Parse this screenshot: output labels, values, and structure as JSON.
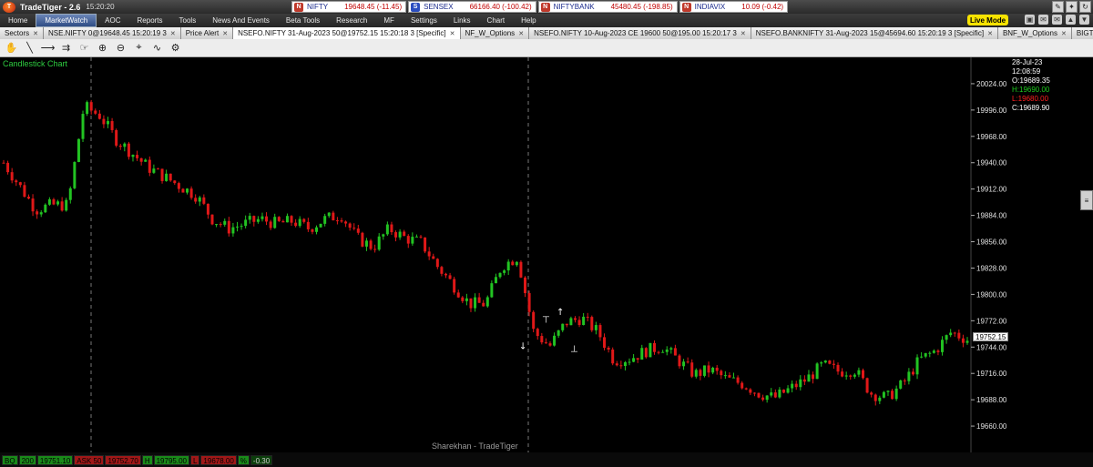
{
  "app": {
    "title": "TradeTiger - 2.6",
    "time": "15:20:20",
    "logo": "T"
  },
  "tickers": [
    {
      "icon_color": "#c0392b",
      "icon": "N",
      "name": "NIFTY",
      "value": "19648.45 (-11.45)"
    },
    {
      "icon_color": "#2b4ec0",
      "icon": "S",
      "name": "SENSEX",
      "value": "66166.40 (-100.42)"
    },
    {
      "icon_color": "#c0392b",
      "icon": "N",
      "name": "NIFTYBANK",
      "value": "45480.45 (-198.85)"
    },
    {
      "icon_color": "#c0392b",
      "icon": "N",
      "name": "INDIAVIX",
      "value": "10.09 (-0.42)"
    }
  ],
  "window_controls": [
    "✎",
    "✦",
    "↻"
  ],
  "menu": [
    "Home",
    "MarketWatch",
    "AOC",
    "Reports",
    "Tools",
    "News And Events",
    "Beta Tools",
    "Research",
    "MF",
    "Settings",
    "Links",
    "Chart",
    "Help"
  ],
  "menu_active_index": 1,
  "live_mode": "Live Mode",
  "menu_icons": [
    "▣",
    "✉",
    "✉",
    "▲",
    "▼"
  ],
  "tabs": [
    "Sectors",
    "NSE.NIFTY 0@19648.45 15:20:19 3",
    "Price Alert",
    "NSEFO.NIFTY 31-Aug-2023 50@19752.15 15:20:18 3 [Specific]",
    "NF_W_Options",
    "NSEFO.NIFTY 10-Aug-2023 CE 19600 50@195.00 15:20:17 3",
    "NSEFO.BANKNIFTY 31-Aug-2023 15@45694.60 15:20:19 3 [Specific]",
    "BNF_W_Options",
    "BIGTRADELIST"
  ],
  "active_tab_index": 3,
  "toolbar": [
    {
      "name": "pointer-icon",
      "glyph": "✋"
    },
    {
      "name": "line-tool-icon",
      "glyph": "╲"
    },
    {
      "name": "ray-tool-icon",
      "glyph": "⟶"
    },
    {
      "name": "channel-tool-icon",
      "glyph": "⇉"
    },
    {
      "name": "hand-tool-icon",
      "glyph": "☞"
    },
    {
      "name": "zoom-in-icon",
      "glyph": "⊕"
    },
    {
      "name": "zoom-out-icon",
      "glyph": "⊖"
    },
    {
      "name": "crosshair-icon",
      "glyph": "⌖"
    },
    {
      "name": "indicator-icon",
      "glyph": "∿"
    },
    {
      "name": "settings-icon",
      "glyph": "⚙"
    }
  ],
  "chart": {
    "title": "Candlestick Chart",
    "watermark": "Sharekhan - TradeTiger",
    "date": "28-Jul-23",
    "time": "12:08:59",
    "open": "O:19689.35",
    "high": "H:19690.00",
    "low": "L:19680.00",
    "close": "C:19689.90",
    "last_price": "19752.15",
    "side_handle": "≡",
    "up_color": "#22c322",
    "down_color": "#e01818"
  },
  "chart_data": {
    "type": "candlestick",
    "y_ticks": [
      "20024.00",
      "19996.00",
      "19968.00",
      "19940.00",
      "19912.00",
      "19884.00",
      "19856.00",
      "19828.00",
      "19800.00",
      "19772.00",
      "19744.00",
      "19716.00",
      "19688.00",
      "19660.00"
    ],
    "ylim": [
      19632,
      20052
    ],
    "close_path": [
      19940,
      19915,
      19890,
      19895,
      19895,
      20000,
      19990,
      19965,
      19950,
      19935,
      19925,
      19915,
      19905,
      19880,
      19870,
      19875,
      19880,
      19875,
      19878,
      19870,
      19880,
      19885,
      19860,
      19850,
      19870,
      19860,
      19855,
      19830,
      19810,
      19790,
      19790,
      19830,
      19840,
      19760,
      19745,
      19770,
      19775,
      19760,
      19730,
      19732,
      19740,
      19745,
      19730,
      19715,
      19720,
      19710,
      19705,
      19695,
      19690,
      19700,
      19710,
      19725,
      19718,
      19720,
      19695,
      19690,
      19705,
      19730,
      19740,
      19760,
      19752
    ]
  },
  "status_bar": [
    {
      "text": "BQ",
      "style": "g"
    },
    {
      "text": "200",
      "style": "g"
    },
    {
      "text": "19751.10",
      "style": "g"
    },
    {
      "text": "ASK 50",
      "style": "r"
    },
    {
      "text": "19752.70",
      "style": "r"
    },
    {
      "text": "H",
      "style": "g"
    },
    {
      "text": "19795.00",
      "style": "g"
    },
    {
      "text": "L",
      "style": "r"
    },
    {
      "text": "19678.00",
      "style": "r"
    },
    {
      "text": "%",
      "style": "g"
    },
    {
      "text": "-0.30",
      "style": "d"
    }
  ]
}
